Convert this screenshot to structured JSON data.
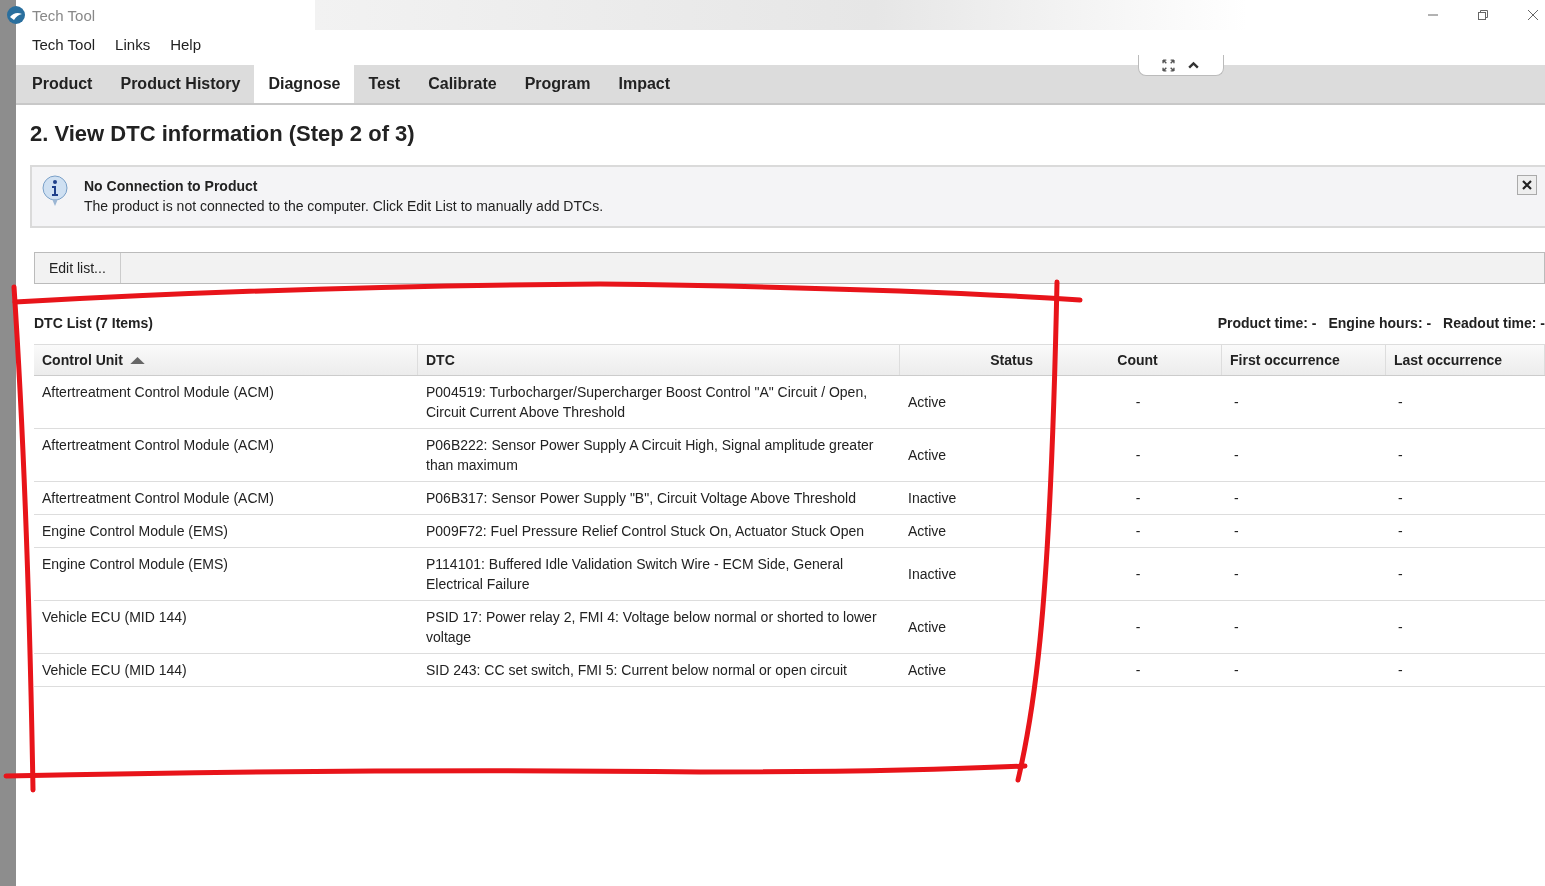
{
  "window": {
    "title": "Tech Tool"
  },
  "menu": [
    "Tech Tool",
    "Links",
    "Help"
  ],
  "tabs": [
    {
      "label": "Product",
      "selected": false
    },
    {
      "label": "Product History",
      "selected": false
    },
    {
      "label": "Diagnose",
      "selected": true
    },
    {
      "label": "Test",
      "selected": false
    },
    {
      "label": "Calibrate",
      "selected": false
    },
    {
      "label": "Program",
      "selected": false
    },
    {
      "label": "Impact",
      "selected": false
    }
  ],
  "heading": "2. View DTC information (Step 2 of 3)",
  "notice": {
    "title": "No Connection to Product",
    "message": "The product is not connected to the computer. Click Edit List to manually add DTCs."
  },
  "edit_button": "Edit list...",
  "dtc_list": {
    "title": "DTC List (7 Items)",
    "meta": [
      "Product time: -",
      "Engine hours: -",
      "Readout time: -"
    ],
    "columns": [
      {
        "label": "Control Unit",
        "sorted": true
      },
      {
        "label": "DTC",
        "sorted": false
      },
      {
        "label": "Status",
        "sorted": false
      },
      {
        "label": "Count",
        "sorted": false
      },
      {
        "label": "First occurrence",
        "sorted": false
      },
      {
        "label": "Last occurrence",
        "sorted": false
      }
    ],
    "rows": [
      {
        "control_unit": "Aftertreatment Control Module (ACM)",
        "dtc": "P004519: Turbocharger/Supercharger Boost Control \"A\" Circuit / Open, Circuit Current Above Threshold",
        "status": "Active",
        "count": "-",
        "first": "-",
        "last": "-"
      },
      {
        "control_unit": "Aftertreatment Control Module (ACM)",
        "dtc": "P06B222: Sensor Power Supply A Circuit High, Signal amplitude greater than maximum",
        "status": "Active",
        "count": "-",
        "first": "-",
        "last": "-"
      },
      {
        "control_unit": "Aftertreatment Control Module (ACM)",
        "dtc": "P06B317: Sensor Power Supply \"B\", Circuit Voltage Above Threshold",
        "status": "Inactive",
        "count": "-",
        "first": "-",
        "last": "-"
      },
      {
        "control_unit": "Engine Control Module (EMS)",
        "dtc": "P009F72: Fuel Pressure Relief Control Stuck On, Actuator Stuck Open",
        "status": "Active",
        "count": "-",
        "first": "-",
        "last": "-"
      },
      {
        "control_unit": "Engine Control Module (EMS)",
        "dtc": "P114101: Buffered Idle Validation Switch Wire - ECM Side, General Electrical Failure",
        "status": "Inactive",
        "count": "-",
        "first": "-",
        "last": "-"
      },
      {
        "control_unit": "Vehicle ECU (MID 144)",
        "dtc": "PSID 17: Power relay 2, FMI 4: Voltage below normal or shorted to lower voltage",
        "status": "Active",
        "count": "-",
        "first": "-",
        "last": "-"
      },
      {
        "control_unit": "Vehicle ECU (MID 144)",
        "dtc": "SID 243: CC set switch, FMI 5: Current below normal or open circuit",
        "status": "Active",
        "count": "-",
        "first": "-",
        "last": "-"
      }
    ]
  }
}
